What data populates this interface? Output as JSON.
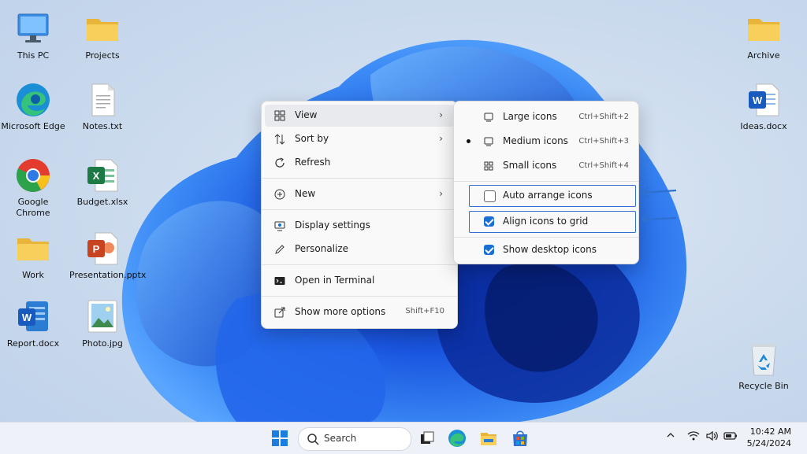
{
  "desktop": {
    "left_icons": [
      {
        "label": "This PC",
        "icon": "computer-icon"
      },
      {
        "label": "Microsoft Edge",
        "icon": "edge-icon"
      },
      {
        "label": "Google Chrome",
        "icon": "chrome-icon"
      },
      {
        "label": "Work",
        "icon": "folder-icon"
      },
      {
        "label": "Report.docx",
        "icon": "word-icon"
      }
    ],
    "middle_icons": [
      {
        "label": "Projects",
        "icon": "folder-icon"
      },
      {
        "label": "Notes.txt",
        "icon": "text-file-icon"
      },
      {
        "label": "Budget.xlsx",
        "icon": "excel-icon"
      },
      {
        "label": "Presentation.pptx",
        "icon": "powerpoint-icon"
      },
      {
        "label": "Photo.jpg",
        "icon": "image-icon"
      }
    ],
    "right_icons": [
      {
        "label": "Archive",
        "icon": "folder-icon"
      },
      {
        "label": "Ideas.docx",
        "icon": "word-icon"
      },
      {
        "label": "Recycle Bin",
        "icon": "recycle-bin-icon"
      }
    ]
  },
  "context_menu": {
    "items": [
      {
        "label": "View",
        "icon": "grid-icon",
        "has_submenu": true
      },
      {
        "label": "Sort by",
        "icon": "sort-icon",
        "has_submenu": true
      },
      {
        "label": "Refresh",
        "icon": "refresh-icon"
      },
      {
        "label": "New",
        "icon": "plus-circle-icon",
        "has_submenu": true
      },
      {
        "label": "Display settings",
        "icon": "display-icon"
      },
      {
        "label": "Personalize",
        "icon": "pen-icon"
      },
      {
        "label": "Open in Terminal",
        "icon": "terminal-icon"
      },
      {
        "label": "Show more options",
        "icon": "share-icon",
        "shortcut": "Shift+F10"
      }
    ]
  },
  "view_submenu": {
    "items": [
      {
        "label": "Large icons",
        "shortcut": "Ctrl+Shift+2",
        "selected": false
      },
      {
        "label": "Medium icons",
        "shortcut": "Ctrl+Shift+3",
        "selected": true
      },
      {
        "label": "Small icons",
        "shortcut": "Ctrl+Shift+4",
        "selected": false
      },
      {
        "label": "Auto arrange icons",
        "checked": false
      },
      {
        "label": "Align icons to grid",
        "checked": true
      },
      {
        "label": "Show desktop icons",
        "checked": true
      }
    ]
  },
  "taskbar": {
    "search_placeholder": "Search",
    "time": "10:42 AM",
    "date": "5/24/2024"
  },
  "colors": {
    "accent": "#1a6fd6",
    "annotation": "#2f6fd0",
    "wallpaper_bloom": "#1f5fe0"
  }
}
